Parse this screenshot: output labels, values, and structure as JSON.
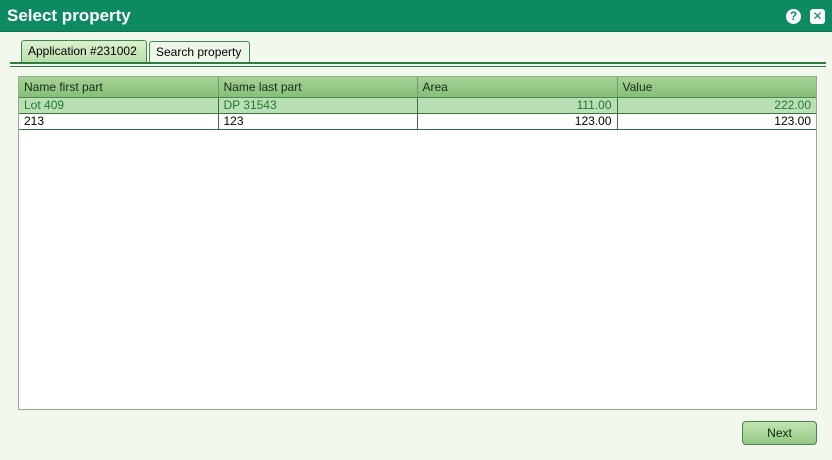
{
  "window": {
    "title": "Select property",
    "help_label": "?",
    "close_label": "✕"
  },
  "tabs": [
    {
      "label": "Application #231002",
      "active": true
    },
    {
      "label": "Search property",
      "active": false
    }
  ],
  "table": {
    "columns": [
      "Name first part",
      "Name last part",
      "Area",
      "Value"
    ],
    "rows": [
      {
        "first": "Lot 409",
        "last": "DP 31543",
        "area": "111.00",
        "value": "222.00",
        "selected": true
      },
      {
        "first": "213",
        "last": "123",
        "area": "123.00",
        "value": "123.00",
        "selected": false
      }
    ]
  },
  "footer": {
    "next_label": "Next"
  },
  "colors": {
    "titlebar": "#0d8a5f",
    "selected_row": "#b8e0b4",
    "selected_text": "#1f7a2e"
  }
}
